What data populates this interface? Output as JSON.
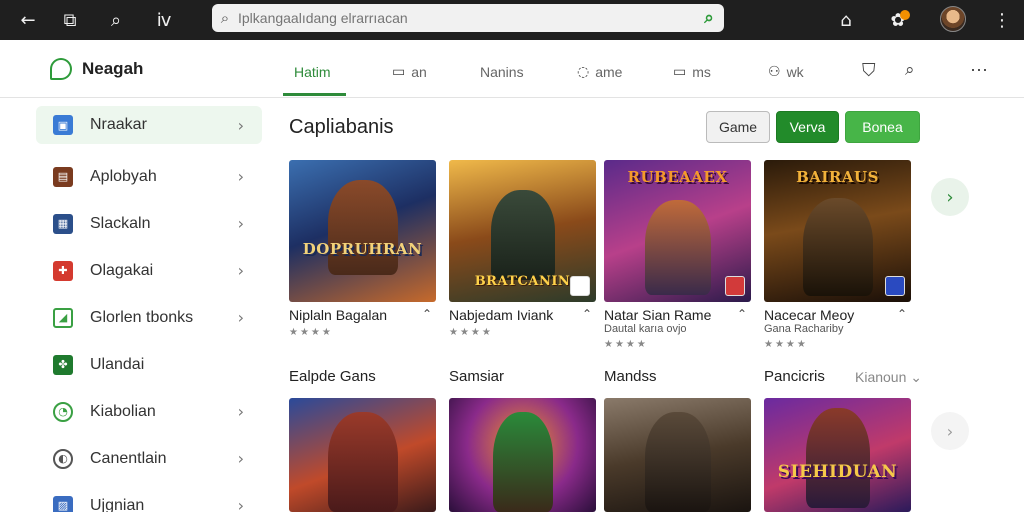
{
  "browser": {
    "back_icon": "arrow-left-icon",
    "search_placeholder": "Iplkangaalıdang elrarrıacan"
  },
  "app": {
    "name": "Neagah",
    "tabs": [
      {
        "label": "Hatim",
        "icon": ""
      },
      {
        "label": "an",
        "icon": "▭"
      },
      {
        "label": "Nanins",
        "icon": ""
      },
      {
        "label": "ame",
        "icon": "◌"
      },
      {
        "label": "ms",
        "icon": "▭"
      },
      {
        "label": "wk",
        "icon": "⚇"
      }
    ]
  },
  "sidebar": {
    "items": [
      {
        "label": "Nraakar",
        "color": "#3a7bd5",
        "chevron": true
      },
      {
        "label": "Aplobyah",
        "color": "#7a3b1f",
        "chevron": true
      },
      {
        "label": "Slackaln",
        "color": "#2b4f8a",
        "chevron": true
      },
      {
        "label": "Olagakai",
        "color": "#d43a2f",
        "chevron": true
      },
      {
        "label": "Glorlen tbonks",
        "color": "#3aa043",
        "chevron": true
      },
      {
        "label": "Ulandai",
        "color": "#1f7a2e",
        "chevron": false
      },
      {
        "label": "Kiabolian",
        "color": "#3aa043",
        "chevron": true
      },
      {
        "label": "Canentlain",
        "color": "#555555",
        "chevron": true
      },
      {
        "label": "Ujgnian",
        "color": "#3a6cc0",
        "chevron": true
      }
    ]
  },
  "main": {
    "section_title": "Capliabanis",
    "filters": {
      "game": "Game",
      "menu": "Verva",
      "bonus": "Bonea"
    },
    "row1": [
      {
        "banner": "DOPRUHRAN",
        "title": "Niplaln Bagalan",
        "subtitle": "",
        "stars": "★★★★"
      },
      {
        "banner": "BRATCANIN",
        "title": "Nabjedam Iviank",
        "subtitle": "",
        "stars": "★★★★"
      },
      {
        "banner": "RUBEAAEX",
        "title": "Natar Sian Rame",
        "subtitle": "Dautal karıa ovjo",
        "stars": "★★★★"
      },
      {
        "banner": "BAIRAUS",
        "title": "Nacecar Meoy",
        "subtitle": "Gana Rachariby",
        "stars": "★★★★"
      }
    ],
    "row2_labels": [
      "Ealpde Gans",
      "Samsiar",
      "Mandss",
      "Pancicris"
    ],
    "row2_more": "Kianoun",
    "row2": [
      {
        "banner": ""
      },
      {
        "banner": ""
      },
      {
        "banner": ""
      },
      {
        "banner": "SIEHIDUAN"
      }
    ]
  }
}
